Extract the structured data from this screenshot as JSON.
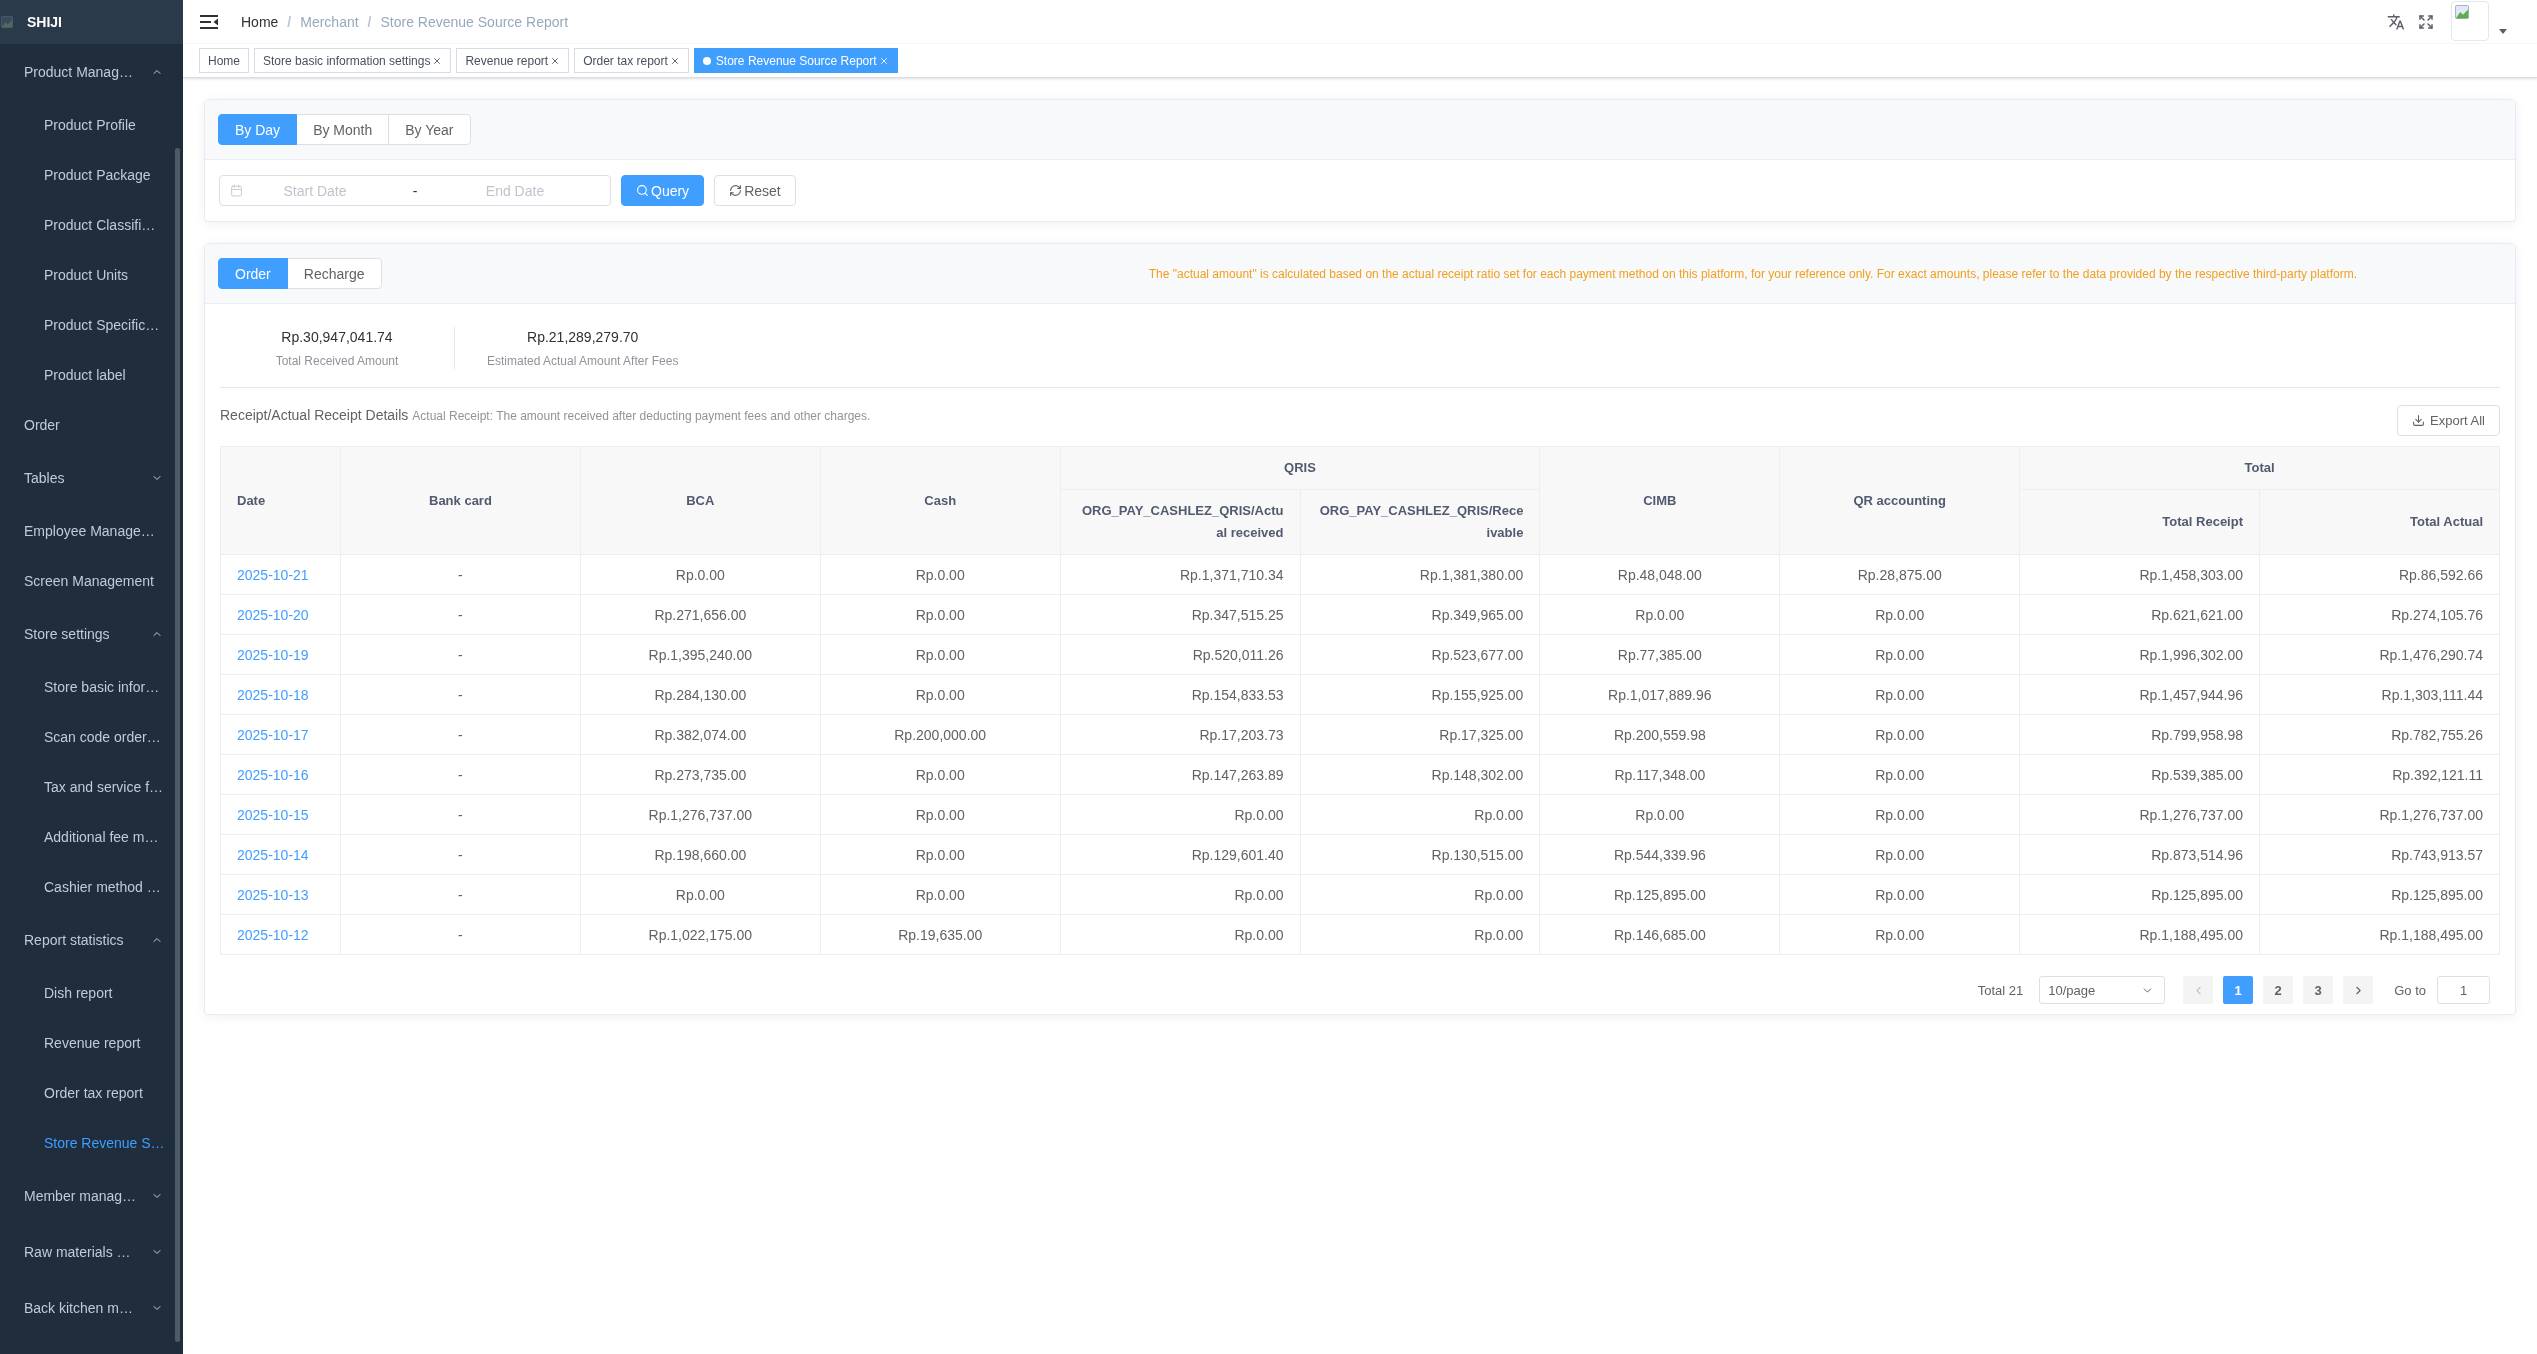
{
  "sidebar": {
    "brand": "SHIJI",
    "items": [
      {
        "label": "Product Manag…",
        "kind": "group",
        "expanded": true,
        "children": [
          {
            "label": "Product Profile",
            "selected": false
          },
          {
            "label": "Product Package",
            "selected": false
          },
          {
            "label": "Product Classifi…",
            "selected": false
          },
          {
            "label": "Product Units",
            "selected": false
          },
          {
            "label": "Product Specific…",
            "selected": false
          },
          {
            "label": "Product label",
            "selected": false
          }
        ]
      },
      {
        "label": "Order",
        "kind": "item",
        "selected": false
      },
      {
        "label": "Tables",
        "kind": "group",
        "expanded": false
      },
      {
        "label": "Employee Manage…",
        "kind": "item",
        "selected": false
      },
      {
        "label": "Screen Management",
        "kind": "item",
        "selected": false
      },
      {
        "label": "Store settings",
        "kind": "group",
        "expanded": true,
        "children": [
          {
            "label": "Store basic infor…",
            "selected": false
          },
          {
            "label": "Scan code order…",
            "selected": false
          },
          {
            "label": "Tax and service f…",
            "selected": false
          },
          {
            "label": "Additional fee m…",
            "selected": false
          },
          {
            "label": "Cashier method …",
            "selected": false
          }
        ]
      },
      {
        "label": "Report statistics",
        "kind": "group",
        "expanded": true,
        "children": [
          {
            "label": "Dish report",
            "selected": false
          },
          {
            "label": "Revenue report",
            "selected": false
          },
          {
            "label": "Order tax report",
            "selected": false
          },
          {
            "label": "Store Revenue S…",
            "selected": true
          }
        ]
      },
      {
        "label": "Member manag…",
        "kind": "group",
        "expanded": false
      },
      {
        "label": "Raw materials …",
        "kind": "group",
        "expanded": false
      },
      {
        "label": "Back kitchen m…",
        "kind": "group",
        "expanded": false
      }
    ]
  },
  "header": {
    "breadcrumb": [
      {
        "label": "Home",
        "kind": "link"
      },
      {
        "label": "/",
        "kind": "separator"
      },
      {
        "label": "Merchant",
        "kind": "text"
      },
      {
        "label": "/",
        "kind": "separator"
      },
      {
        "label": "Store Revenue Source Report",
        "kind": "text"
      }
    ]
  },
  "tags": [
    {
      "label": "Home",
      "closable": false,
      "selected": false
    },
    {
      "label": "Store basic information settings",
      "closable": true,
      "selected": false
    },
    {
      "label": "Revenue report",
      "closable": true,
      "selected": false
    },
    {
      "label": "Order tax report",
      "closable": true,
      "selected": false
    },
    {
      "label": "Store Revenue Source Report",
      "closable": true,
      "selected": true
    }
  ],
  "filter": {
    "periods": [
      {
        "label": "By Day",
        "selected": true
      },
      {
        "label": "By Month",
        "selected": false
      },
      {
        "label": "By Year",
        "selected": false
      }
    ],
    "date_range": {
      "start": {
        "placeholder": "Start Date"
      },
      "separator": "-",
      "end": {
        "placeholder": "End Date"
      }
    },
    "buttons": [
      {
        "label": "Query",
        "kind": "query"
      },
      {
        "label": "Reset",
        "kind": "reset"
      }
    ]
  },
  "report": {
    "types": [
      {
        "label": "Order",
        "selected": true
      },
      {
        "label": "Recharge",
        "selected": false
      }
    ],
    "notice": "The \"actual amount\" is calculated based on the actual receipt ratio set for each payment method on this platform, for your reference only. For exact amounts, please refer to the data provided by the respective third-party platform.",
    "stats": [
      {
        "value": "Rp.30,947,041.74",
        "label": "Total Received Amount"
      },
      {
        "value": "Rp.21,289,279.70",
        "label": "Estimated Actual Amount After Fees"
      }
    ],
    "details_title": "Receipt/Actual Receipt Details",
    "details_note": "Actual Receipt: The amount received after deducting payment fees and other charges.",
    "export_button": "Export All",
    "table": {
      "columns": [
        {
          "label": "Date",
          "kind": "date"
        },
        {
          "label": "Bank card",
          "kind": "amount"
        },
        {
          "label": "BCA",
          "kind": "amount"
        },
        {
          "label": "Cash",
          "kind": "amount"
        },
        {
          "label": "QRIS",
          "kind": "group",
          "colspan": 2,
          "children": [
            {
              "label": "ORG_PAY_CASHLEZ_QRIS/Actual received"
            },
            {
              "label": "ORG_PAY_CASHLEZ_QRIS/Receivable"
            }
          ]
        },
        {
          "label": "CIMB",
          "kind": "amount"
        },
        {
          "label": "QR accounting",
          "kind": "amount"
        },
        {
          "label": "Total",
          "kind": "group",
          "colspan": 2,
          "children": [
            {
              "label": "Total Receipt"
            },
            {
              "label": "Total Actual"
            }
          ]
        }
      ],
      "rows": [
        [
          "2025-10-21",
          "-",
          "Rp.0.00",
          "Rp.0.00",
          "Rp.1,371,710.34",
          "Rp.1,381,380.00",
          "Rp.48,048.00",
          "Rp.28,875.00",
          "Rp.1,458,303.00",
          "Rp.86,592.66"
        ],
        [
          "2025-10-20",
          "-",
          "Rp.271,656.00",
          "Rp.0.00",
          "Rp.347,515.25",
          "Rp.349,965.00",
          "Rp.0.00",
          "Rp.0.00",
          "Rp.621,621.00",
          "Rp.274,105.76"
        ],
        [
          "2025-10-19",
          "-",
          "Rp.1,395,240.00",
          "Rp.0.00",
          "Rp.520,011.26",
          "Rp.523,677.00",
          "Rp.77,385.00",
          "Rp.0.00",
          "Rp.1,996,302.00",
          "Rp.1,476,290.74"
        ],
        [
          "2025-10-18",
          "-",
          "Rp.284,130.00",
          "Rp.0.00",
          "Rp.154,833.53",
          "Rp.155,925.00",
          "Rp.1,017,889.96",
          "Rp.0.00",
          "Rp.1,457,944.96",
          "Rp.1,303,111.44"
        ],
        [
          "2025-10-17",
          "-",
          "Rp.382,074.00",
          "Rp.200,000.00",
          "Rp.17,203.73",
          "Rp.17,325.00",
          "Rp.200,559.98",
          "Rp.0.00",
          "Rp.799,958.98",
          "Rp.782,755.26"
        ],
        [
          "2025-10-16",
          "-",
          "Rp.273,735.00",
          "Rp.0.00",
          "Rp.147,263.89",
          "Rp.148,302.00",
          "Rp.117,348.00",
          "Rp.0.00",
          "Rp.539,385.00",
          "Rp.392,121.11"
        ],
        [
          "2025-10-15",
          "-",
          "Rp.1,276,737.00",
          "Rp.0.00",
          "Rp.0.00",
          "Rp.0.00",
          "Rp.0.00",
          "Rp.0.00",
          "Rp.1,276,737.00",
          "Rp.1,276,737.00"
        ],
        [
          "2025-10-14",
          "-",
          "Rp.198,660.00",
          "Rp.0.00",
          "Rp.129,601.40",
          "Rp.130,515.00",
          "Rp.544,339.96",
          "Rp.0.00",
          "Rp.873,514.96",
          "Rp.743,913.57"
        ],
        [
          "2025-10-13",
          "-",
          "Rp.0.00",
          "Rp.0.00",
          "Rp.0.00",
          "Rp.0.00",
          "Rp.125,895.00",
          "Rp.0.00",
          "Rp.125,895.00",
          "Rp.125,895.00"
        ],
        [
          "2025-10-12",
          "-",
          "Rp.1,022,175.00",
          "Rp.19,635.00",
          "Rp.0.00",
          "Rp.0.00",
          "Rp.146,685.00",
          "Rp.0.00",
          "Rp.1,188,495.00",
          "Rp.1,188,495.00"
        ]
      ]
    },
    "pagination": {
      "total": "Total 21",
      "page_size": "10/page",
      "prev_disabled": true,
      "next_disabled": false,
      "pages": [
        {
          "label": "1",
          "selected": true
        },
        {
          "label": "2",
          "selected": false
        },
        {
          "label": "3",
          "selected": false
        }
      ],
      "jumper": {
        "label": "Go to",
        "value": "1"
      }
    }
  }
}
